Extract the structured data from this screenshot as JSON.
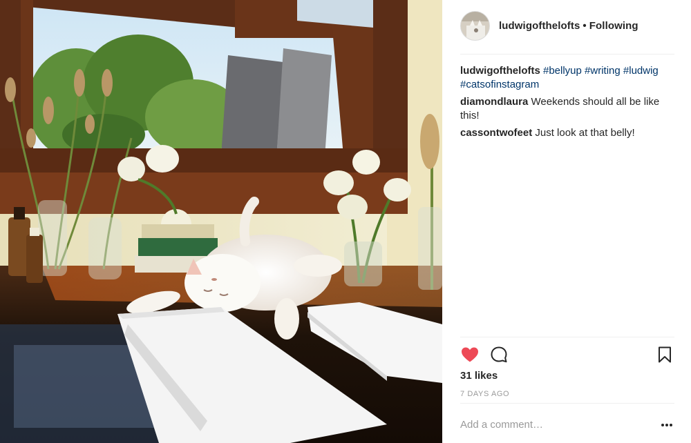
{
  "post": {
    "photo_alt": "",
    "author": {
      "username": "ludwigofthelofts",
      "separator": "•",
      "follow_status": "Following"
    },
    "caption": {
      "username": "ludwigofthelofts",
      "hashtags": [
        "#bellyup",
        "#writing",
        "#ludwig",
        "#catsofinstagram"
      ]
    },
    "comments": [
      {
        "username": "diamondlaura",
        "text": "Weekends should all be like this!"
      },
      {
        "username": "cassontwofeet",
        "text": "Just look at that belly!"
      }
    ],
    "actions": {
      "like_icon": "heart-filled-icon",
      "comment_icon": "speech-bubble-icon",
      "save_icon": "bookmark-icon",
      "like_color": "#ed4956"
    },
    "likes_text": "31 likes",
    "timestamp": "7 DAYS AGO",
    "add_comment_placeholder": "Add a comment…",
    "more_icon": "ellipsis-icon"
  },
  "colors": {
    "text": "#262626",
    "hashtag": "#003569",
    "muted": "#999999",
    "divider": "#efefef"
  }
}
